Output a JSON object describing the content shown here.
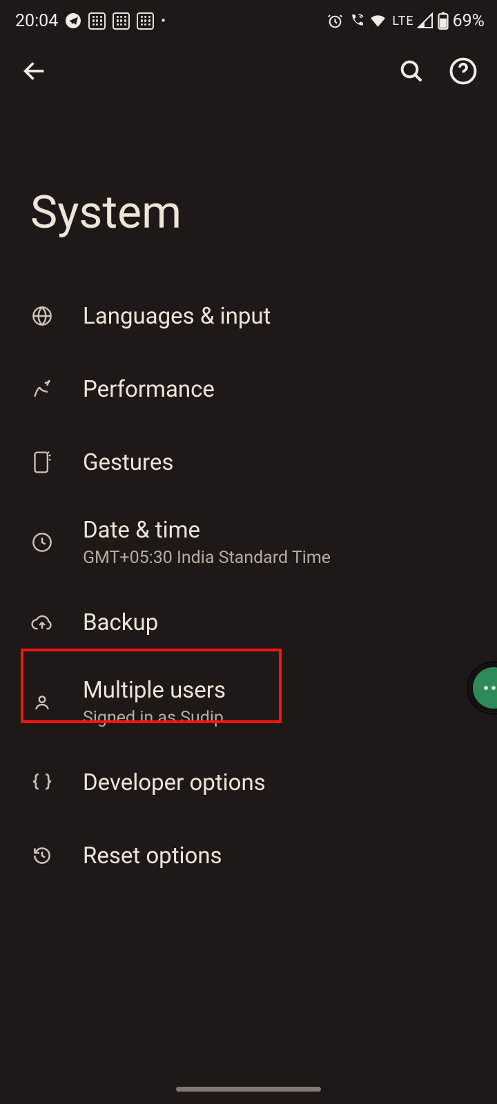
{
  "statusbar": {
    "time": "20:04",
    "lte": "LTE",
    "battery": "69%"
  },
  "page": {
    "title": "System"
  },
  "menu": [
    {
      "label": "Languages & input"
    },
    {
      "label": "Performance"
    },
    {
      "label": "Gestures"
    },
    {
      "label": "Date & time",
      "sub": "GMT+05:30 India Standard Time"
    },
    {
      "label": "Backup"
    },
    {
      "label": "Multiple users",
      "sub": "Signed in as Sudip"
    },
    {
      "label": "Developer options"
    },
    {
      "label": "Reset options"
    }
  ]
}
